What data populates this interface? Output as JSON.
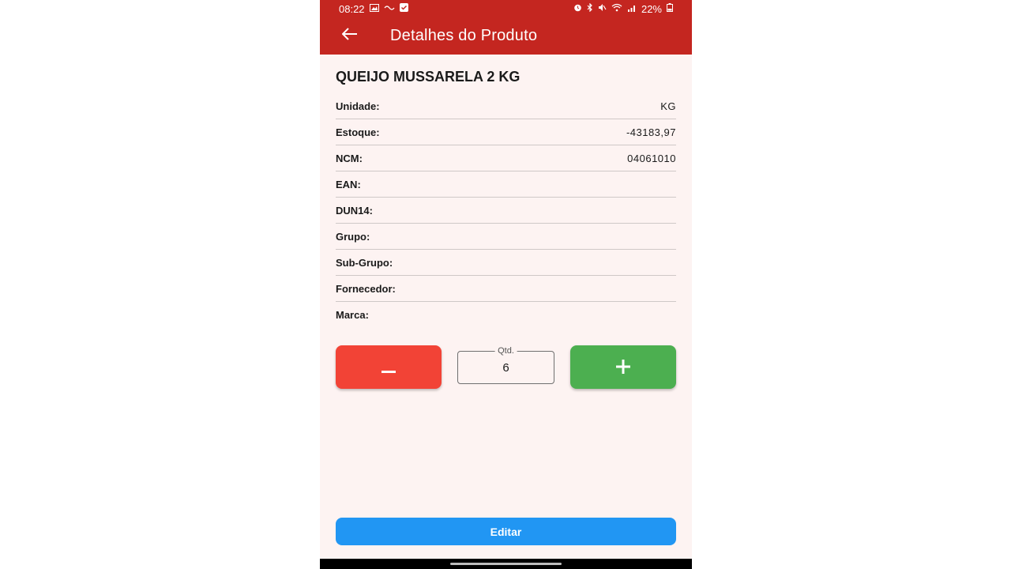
{
  "status_bar": {
    "time": "08:22",
    "battery": "22%",
    "left_icons": [
      "gallery-icon",
      "hd-icon",
      "check-icon"
    ],
    "right_icons": [
      "alarm-icon",
      "bluetooth-icon",
      "mute-icon",
      "wifi-icon",
      "signal-icon",
      "battery-icon"
    ]
  },
  "app_bar": {
    "title": "Detalhes do Produto",
    "background": "#c42620"
  },
  "product": {
    "name": "QUEIJO MUSSARELA 2 KG",
    "details": [
      {
        "label": "Unidade:",
        "value": "KG"
      },
      {
        "label": "Estoque:",
        "value": "-43183,97"
      },
      {
        "label": "NCM:",
        "value": "04061010"
      },
      {
        "label": "EAN:",
        "value": ""
      },
      {
        "label": "DUN14:",
        "value": ""
      },
      {
        "label": "Grupo:",
        "value": ""
      },
      {
        "label": "Sub-Grupo:",
        "value": ""
      },
      {
        "label": "Fornecedor:",
        "value": ""
      },
      {
        "label": "Marca:",
        "value": ""
      }
    ]
  },
  "quantity": {
    "label": "Qtd.",
    "value": "6",
    "minus_label": "−",
    "plus_label": "+",
    "minus_color": "#f24336",
    "plus_color": "#4caf50"
  },
  "edit_button": {
    "label": "Editar",
    "color": "#2196f3"
  }
}
